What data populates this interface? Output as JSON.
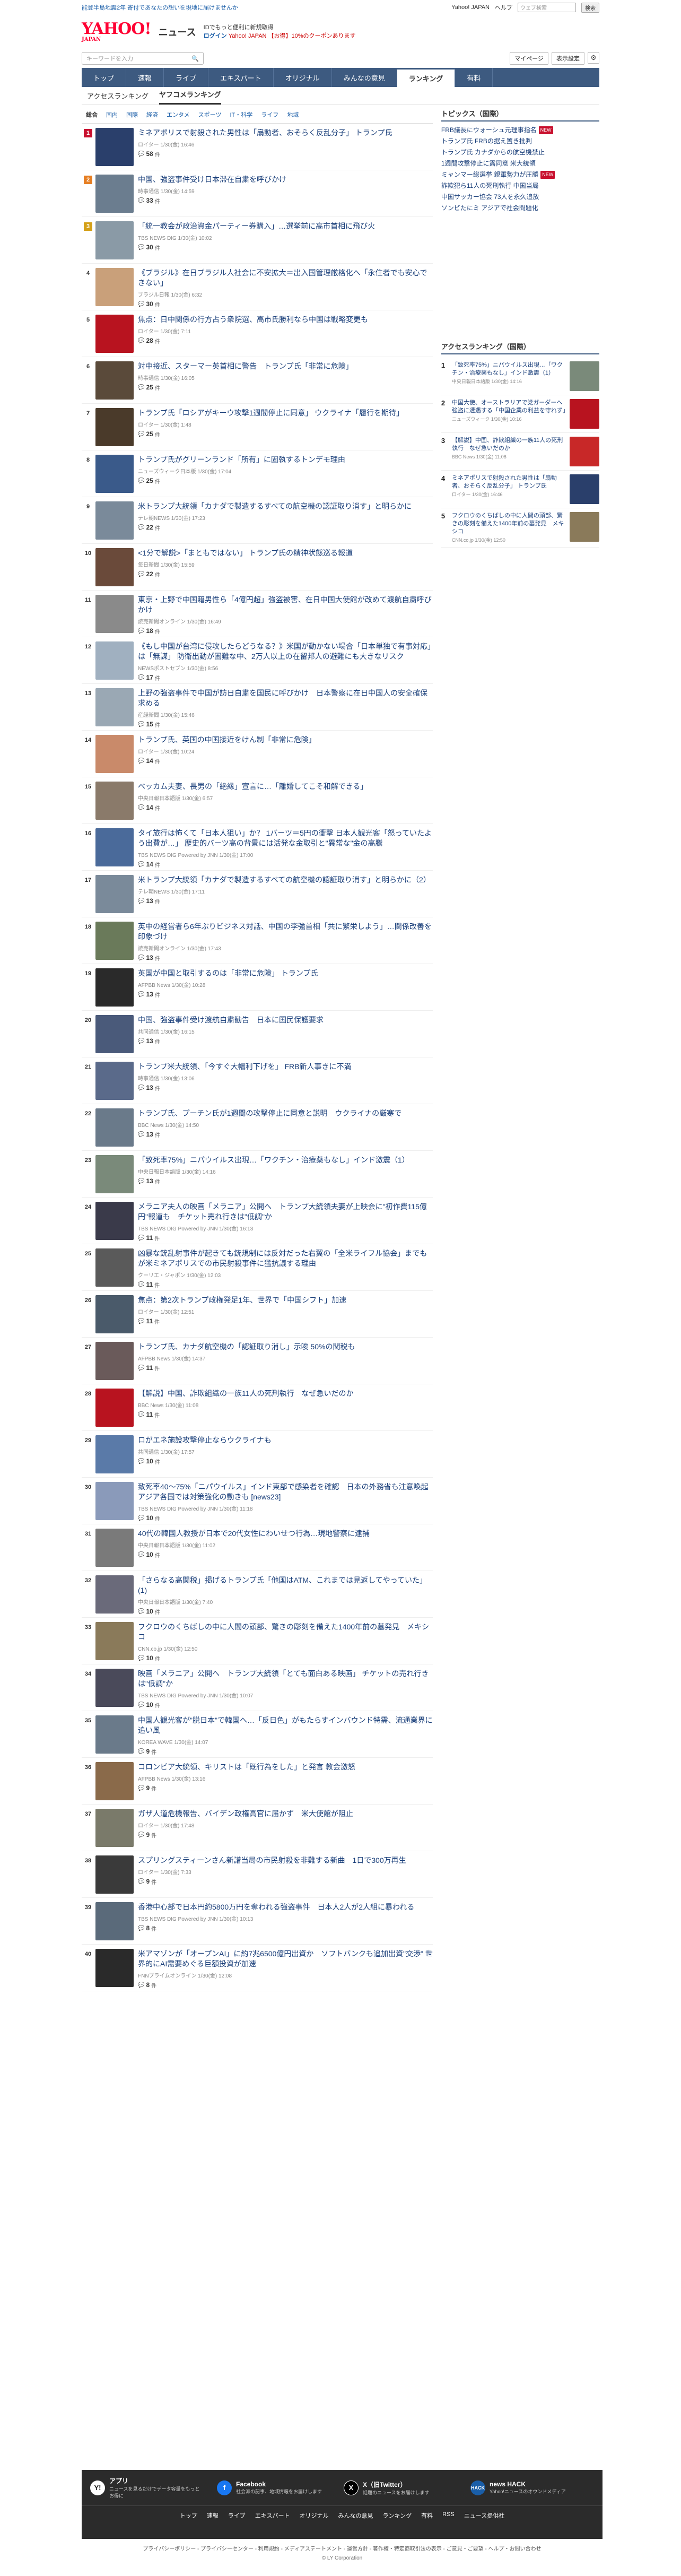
{
  "topbar": {
    "promo": "能登半島地震2年  寄付であなたの想いを現地に届けませんか",
    "links": [
      "Yahoo! JAPAN",
      "ヘルプ"
    ],
    "search_placeholder": "ウェブ検索",
    "search_button": "検索"
  },
  "brand": {
    "logo": "YAHOO!",
    "logo_sub_small": "JAPAN",
    "service": "ニュース",
    "account_line1": "IDでもっと便利に新規取得",
    "login": "ログイン",
    "ppoint": "Yahoo! JAPAN 【お得】10%のクーポンあります"
  },
  "search": {
    "placeholder": "キーワードを入力",
    "mypage": "マイページ",
    "display": "表示設定"
  },
  "nav": [
    "トップ",
    "速報",
    "ライブ",
    "エキスパート",
    "オリジナル",
    "みんなの意見",
    "ランキング",
    "有料"
  ],
  "nav_active": "ランキング",
  "subtabs": [
    "アクセスランキング",
    "ヤフコメランキング"
  ],
  "subtab_active": "ヤフコメランキング",
  "categories": [
    "総合",
    "国内",
    "国際",
    "経済",
    "エンタメ",
    "スポーツ",
    "IT・科学",
    "ライフ",
    "地域"
  ],
  "category_active": "総合",
  "comment_unit": "件",
  "ranking": [
    {
      "n": "1",
      "title": "ミネアポリスで射殺された男性は「扇動者、おそらく反乱分子」 トランプ氏",
      "meta": "ロイター 1/30(金) 16:46",
      "count": "58",
      "color": "#2a3f6b"
    },
    {
      "n": "2",
      "title": "中国、強盗事件受け日本滞在自粛を呼びかけ",
      "meta": "時事通信 1/30(金) 14:59",
      "count": "33",
      "color": "#6b7d8f"
    },
    {
      "n": "3",
      "title": "「統一教会が政治資金パーティー券購入」…選挙前に高市首相に飛び火",
      "meta": "TBS NEWS DIG 1/30(金) 10:02",
      "count": "30",
      "color": "#8a9aa6"
    },
    {
      "n": "4",
      "title": "《ブラジル》在日ブラジル人社会に不安拡大＝出入国管理厳格化へ「永住者でも安心できない」",
      "meta": "ブラジル日報 1/30(金) 6:32",
      "count": "30",
      "color": "#c9a07a"
    },
    {
      "n": "5",
      "title": "焦点：日中関係の行方占う衆院選、高市氏勝利なら中国は戦略変更も",
      "meta": "ロイター 1/30(金) 7:11",
      "count": "28",
      "color": "#b8131f"
    },
    {
      "n": "6",
      "title": "対中接近、スターマー英首相に警告　トランプ氏「非常に危険」",
      "meta": "時事通信 1/30(金) 16:05",
      "count": "25",
      "color": "#5a4a3a"
    },
    {
      "n": "7",
      "title": "トランプ氏「ロシアがキーウ攻撃1週間停止に同意」 ウクライナ「履行を期待」",
      "meta": "ロイター 1/30(金) 1:48",
      "count": "25",
      "color": "#4a3a2a"
    },
    {
      "n": "8",
      "title": "トランプ氏がグリーンランド「所有」に固執するトンデモ理由",
      "meta": "ニューズウィーク日本版 1/30(金) 17:04",
      "count": "25",
      "color": "#3a5a8a"
    },
    {
      "n": "9",
      "title": "米トランプ大統領「カナダで製造するすべての航空機の認証取り消す」と明らかに",
      "meta": "テレ朝NEWS 1/30(金) 17:23",
      "count": "22",
      "color": "#7a8a9a"
    },
    {
      "n": "10",
      "title": "<1分で解説>「まともではない」 トランプ氏の精神状態巡る報道",
      "meta": "毎日新聞 1/30(金) 15:59",
      "count": "22",
      "color": "#6a4a3a"
    },
    {
      "n": "11",
      "title": "東京・上野で中国籍男性ら「4億円超」強盗被害、在日中国大使館が改めて渡航自粛呼びかけ",
      "meta": "読売新聞オンライン 1/30(金) 16:49",
      "count": "18",
      "color": "#8a8a8a"
    },
    {
      "n": "12",
      "title": "《もし中国が台湾に侵攻したらどうなる？》米国が動かない場合「日本単独で有事対応」は「無謀」 防衛出動が困難な中、2万人以上の在留邦人の避難にも大きなリスク",
      "meta": "NEWSポストセブン 1/30(金) 8:56",
      "count": "17",
      "color": "#a0b0c0"
    },
    {
      "n": "13",
      "title": "上野の強盗事件で中国が訪日自粛を国民に呼びかけ　日本警察に在日中国人の安全確保求める",
      "meta": "産経新聞 1/30(金) 15:46",
      "count": "15",
      "color": "#9aa8b4"
    },
    {
      "n": "14",
      "title": "トランプ氏、英国の中国接近をけん制「非常に危険」",
      "meta": "ロイター 1/30(金) 10:24",
      "count": "14",
      "color": "#c98a6a"
    },
    {
      "n": "15",
      "title": "ベッカム夫妻、長男の「絶縁」宣言に…「離婚してこそ和解できる」",
      "meta": "中央日報日本語版 1/30(金) 6:57",
      "count": "14",
      "color": "#8a7a6a"
    },
    {
      "n": "16",
      "title": "タイ旅行は怖くて「日本人狙い」か？ 1バーツ＝5円の衝撃 日本人観光客「怒っていたよう出費が…」 歴史的バーツ高の背景には活発な金取引と\"異常な\"金の高騰",
      "meta": "TBS NEWS DIG Powered by JNN 1/30(金) 17:00",
      "count": "14",
      "color": "#4a6a9a"
    },
    {
      "n": "17",
      "title": "米トランプ大統領「カナダで製造するすべての航空機の認証取り消す」と明らかに（2）",
      "meta": "テレ朝NEWS 1/30(金) 17:11",
      "count": "13",
      "color": "#7a8a9a"
    },
    {
      "n": "18",
      "title": "英中の経営者ら6年ぶりビジネス対話、中国の李強首相「共に繁栄しよう」…関係改善を印象づけ",
      "meta": "読売新聞オンライン 1/30(金) 17:43",
      "count": "13",
      "color": "#6a7a5a"
    },
    {
      "n": "19",
      "title": "英国が中国と取引するのは「非常に危険」 トランプ氏",
      "meta": "AFPBB News 1/30(金) 10:28",
      "count": "13",
      "color": "#2a2a2a"
    },
    {
      "n": "20",
      "title": "中国、強盗事件受け渡航自粛勧告　日本に国民保護要求",
      "meta": "共同通信 1/30(金) 16:15",
      "count": "13",
      "color": "#4a5a7a"
    },
    {
      "n": "21",
      "title": "トランプ米大統領、「今すぐ大幅利下げを」 FRB新人事きに不満",
      "meta": "時事通信 1/30(金) 13:06",
      "count": "13",
      "color": "#5a6a8a"
    },
    {
      "n": "22",
      "title": "トランプ氏、プーチン氏が1週間の攻撃停止に同意と説明　ウクライナの厳寒で",
      "meta": "BBC News 1/30(金) 14:50",
      "count": "13",
      "color": "#6a7a8a"
    },
    {
      "n": "23",
      "title": "「致死率75%」ニパウイルス出現…「ワクチン・治療薬もなし」インド激震（1）",
      "meta": "中央日報日本語版 1/30(金) 14:16",
      "count": "13",
      "color": "#7a8a7a"
    },
    {
      "n": "24",
      "title": "メラニア夫人の映画「メラニア」公開へ　トランプ大統領夫妻が上映会に\"初作費115億円\"報道も　チケット売れ行きは\"低調\"か",
      "meta": "TBS NEWS DIG Powered by JNN 1/30(金) 16:13",
      "count": "11",
      "color": "#3a3a4a"
    },
    {
      "n": "25",
      "title": "凶暴な銃乱射事件が起きても銃規制には反対だった右翼の「全米ライフル協会」までもが米ミネアポリスでの市民射殺事件に猛抗議する理由",
      "meta": "クーリエ・ジャポン 1/30(金) 12:03",
      "count": "11",
      "color": "#5a5a5a"
    },
    {
      "n": "26",
      "title": "焦点：第2次トランプ政権発足1年、世界で「中国シフト」加速",
      "meta": "ロイター 1/30(金) 12:51",
      "count": "11",
      "color": "#4a5a6a"
    },
    {
      "n": "27",
      "title": "トランプ氏、カナダ航空機の「認証取り消し」示唆 50%の関税も",
      "meta": "AFPBB News 1/30(金) 14:37",
      "count": "11",
      "color": "#6a5a5a"
    },
    {
      "n": "28",
      "title": "【解説】中国、詐欺組織の一族11人の死刑執行　なぜ急いだのか",
      "meta": "BBC News 1/30(金) 11:08",
      "count": "11",
      "color": "#b8131f"
    },
    {
      "n": "29",
      "title": "ロがエネ施設攻撃停止ならウクライナも",
      "meta": "共同通信 1/30(金) 17:57",
      "count": "10",
      "color": "#5a7aa8"
    },
    {
      "n": "30",
      "title": "致死率40～75%「ニパウイルス」インド東部で感染者を確認　日本の外務省も注意喚起　アジア各国では対策強化の動きも [news23]",
      "meta": "TBS NEWS DIG Powered by JNN 1/30(金) 11:18",
      "count": "10",
      "color": "#8a9aba"
    },
    {
      "n": "31",
      "title": "40代の韓国人教授が日本で20代女性にわいせつ行為…現地警察に逮捕",
      "meta": "中央日報日本語版 1/30(金) 11:02",
      "count": "10",
      "color": "#7a7a7a"
    },
    {
      "n": "32",
      "title": "「さらなる高関税」掲げるトランプ氏「他国はATM、これまでは見返してやっていた」(1)",
      "meta": "中央日報日本語版 1/30(金) 7:40",
      "count": "10",
      "color": "#6a6a7a"
    },
    {
      "n": "33",
      "title": "フクロウのくちばしの中に人間の頭部、驚きの彫刻を備えた1400年前の墓発見　メキシコ",
      "meta": "CNN.co.jp 1/30(金) 12:50",
      "count": "10",
      "color": "#8a7a5a"
    },
    {
      "n": "34",
      "title": "映画「メラニア」公開へ　トランプ大統領「とても面白ある映画」 チケットの売れ行きは\"低調\"か",
      "meta": "TBS NEWS DIG Powered by JNN 1/30(金) 10:07",
      "count": "10",
      "color": "#4a4a5a"
    },
    {
      "n": "35",
      "title": "中国人観光客が\"脱日本\"で韓国へ…「反日色」がもたらすインバウンド特需、流通業界に追い風",
      "meta": "KOREA WAVE 1/30(金) 14:07",
      "count": "9",
      "color": "#6a7a8a"
    },
    {
      "n": "36",
      "title": "コロンビア大統領、キリストは「既行為をした」と発言 教会激怒",
      "meta": "AFPBB News 1/30(金) 13:16",
      "count": "9",
      "color": "#8a6a4a"
    },
    {
      "n": "37",
      "title": "ガザ人道危機報告、バイデン政権高官に届かず　米大使館が阻止",
      "meta": "ロイター 1/30(金) 17:48",
      "count": "9",
      "color": "#7a7a6a"
    },
    {
      "n": "38",
      "title": "スプリングスティーンさん新譜当局の市民射殺を非難する新曲　1日で300万再生",
      "meta": "ロイター 1/30(金) 7:33",
      "count": "9",
      "color": "#3a3a3a"
    },
    {
      "n": "39",
      "title": "香港中心部で日本円約5800万円を奪われる強盗事件　日本人2人が2人組に暴われる",
      "meta": "TBS NEWS DIG Powered by JNN 1/30(金) 10:13",
      "count": "8",
      "color": "#5a6a7a"
    },
    {
      "n": "40",
      "title": "米アマゾンが「オープンAI」に約7兆6500億円出資か　ソフトバンクも追加出資\"交渉\" 世界的にAI需要めぐる巨額投資が加速",
      "meta": "FNNプライムオンライン 1/30(金) 12:08",
      "count": "8",
      "color": "#2a2a2a"
    }
  ],
  "topics": {
    "title": "トピックス（国際）",
    "items": [
      {
        "label": "FRB議長にウォーシュ元理事指名",
        "badge": "NEW"
      },
      {
        "label": "トランプ氏 FRBの据え置き批判",
        "badge": ""
      },
      {
        "label": "トランプ氏 カナダからの航空機禁止",
        "badge": ""
      },
      {
        "label": "1週間攻撃停止に露同意 米大統領",
        "badge": ""
      },
      {
        "label": "ミャンマー総選挙 親軍勢力が圧勝",
        "badge": "NEW"
      },
      {
        "label": "詐欺犯ら11人の死刑執行 中国当局",
        "badge": ""
      },
      {
        "label": "中国サッカー協会 73人を永久追放",
        "badge": ""
      },
      {
        "label": "ソンビたにミ アジアで社会問題化",
        "badge": ""
      }
    ]
  },
  "access_ranking": {
    "title": "アクセスランキング（国際）",
    "items": [
      {
        "n": "1",
        "title": "「致死率75%」ニパウイルス出現…「ワクチン・治療薬もなし」インド激震（1）",
        "meta": "中央日報日本語版 1/30(金) 14:16",
        "color": "#7a8a7a"
      },
      {
        "n": "2",
        "title": "中国大使、オーストラリアで党ガーダーへ強盗に遭遇する「中国企業の利益を守れず」",
        "meta": "ニューズウィーク 1/30(金) 10:16",
        "color": "#b8131f"
      },
      {
        "n": "3",
        "title": "【解説】中国、詐欺組織の一族11人の死刑執行　なぜ急いだのか",
        "meta": "BBC News 1/30(金) 11:08",
        "color": "#c82828"
      },
      {
        "n": "4",
        "title": "ミネアポリスで射殺された男性は「扇動者、おそらく反乱分子」 トランプ氏",
        "meta": "ロイター 1/30(金) 16:46",
        "color": "#2a3f6b"
      },
      {
        "n": "5",
        "title": "フクロウのくちばしの中に人間の頭部、驚きの彫刻を備えた1400年前の墓発見　メキシコ",
        "meta": "CNN.co.jp 1/30(金) 12:50",
        "color": "#8a7a5a"
      }
    ]
  },
  "footer": {
    "apps": [
      {
        "icon": "Y!",
        "name": "アプリ",
        "desc": "ニュースを見るだけでデータ容量をもっとお得に"
      },
      {
        "icon": "f",
        "name": "Facebook",
        "desc": "社会派の記事、地域情報をお届けします"
      },
      {
        "icon": "X",
        "name": "X（旧Twitter）",
        "desc": "話題のニュースをお届けします"
      },
      {
        "icon": "HACK",
        "name": "news HACK",
        "desc": "Yahoo!ニュースのオウンドメディア"
      }
    ],
    "nav": [
      "トップ",
      "速報",
      "ライブ",
      "エキスパート",
      "オリジナル",
      "みんなの意見",
      "ランキング",
      "有料",
      "RSS",
      "ニュース提供社"
    ],
    "links": "プライバシーポリシー - プライバシーセンター - 利用規約 - メディアステートメント - 運営方針 - 著作権・特定商取引法の表示 - ご意見・ご要望 - ヘルプ・お問い合わせ",
    "copyright": "© LY Corporation"
  }
}
